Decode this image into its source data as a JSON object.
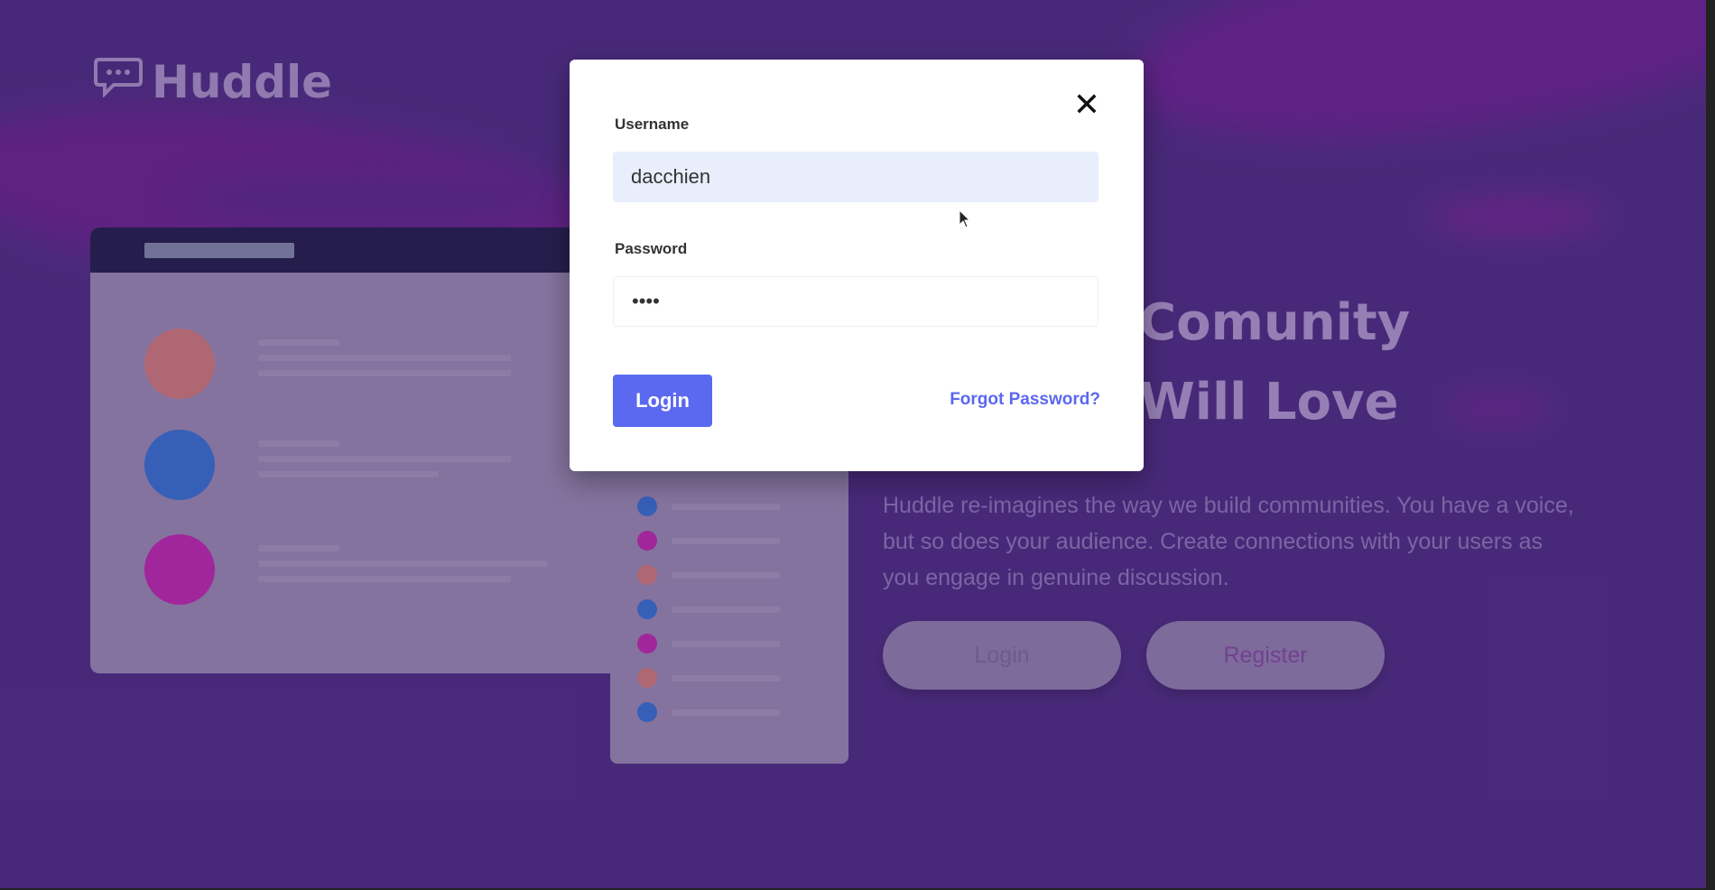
{
  "brand": {
    "name": "Huddle",
    "icon": "chat-bubble-icon"
  },
  "hero": {
    "title_lines": [
      "Comunity",
      "Will Love"
    ],
    "description": "Huddle re-imagines the way we build communities. You have a voice, but so does your audience. Create connections with your users as you engage in genuine discussion.",
    "login_label": "Login",
    "register_label": "Register"
  },
  "mockup": {
    "avatar_colors": [
      "#e98a77",
      "#2f7de0",
      "#d326b4"
    ],
    "dot_colors": [
      "#2f7de0",
      "#d326b4",
      "#e98a77",
      "#2f7de0",
      "#d326b4",
      "#e98a77",
      "#2f7de0"
    ]
  },
  "login_modal": {
    "close_icon": "close-icon",
    "username_label": "Username",
    "username_value": "dacchien",
    "password_label": "Password",
    "password_value": "••••",
    "login_label": "Login",
    "forgot_label": "Forgot Password?"
  },
  "colors": {
    "background": "#4b2a80",
    "accent": "#5b68f0",
    "modal": "#ffffff"
  }
}
